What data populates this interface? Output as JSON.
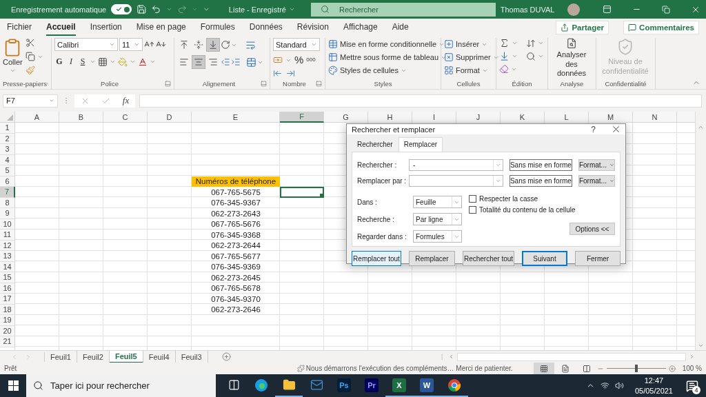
{
  "title_bar": {
    "autosave_label": "Enregistrement automatique",
    "autosave_on": true,
    "document_title": "Liste - Enregistré",
    "search_placeholder": "Rechercher",
    "user_name": "Thomas DUVAL"
  },
  "ribbon": {
    "tabs": [
      {
        "label": "Fichier",
        "selected": false
      },
      {
        "label": "Accueil",
        "selected": true
      },
      {
        "label": "Insertion",
        "selected": false
      },
      {
        "label": "Mise en page",
        "selected": false
      },
      {
        "label": "Formules",
        "selected": false
      },
      {
        "label": "Données",
        "selected": false
      },
      {
        "label": "Révision",
        "selected": false
      },
      {
        "label": "Affichage",
        "selected": false
      },
      {
        "label": "Aide",
        "selected": false
      }
    ],
    "share_label": "Partager",
    "comments_label": "Commentaires",
    "groups": [
      {
        "kind": "clipboard",
        "label": "Presse-papiers",
        "launcher": true,
        "paste_label": "Coller"
      },
      {
        "kind": "font",
        "label": "Police",
        "launcher": true,
        "font_name": "Calibri",
        "font_size": "11",
        "style_buttons": [
          "G",
          "I",
          "S"
        ]
      },
      {
        "kind": "alignment",
        "label": "Alignement",
        "launcher": true,
        "vertical": [
          {
            "selected": false
          },
          {
            "selected": false
          },
          {
            "selected": true
          }
        ],
        "horizontal": [
          {
            "selected": false
          },
          {
            "selected": true
          },
          {
            "selected": false
          }
        ]
      },
      {
        "kind": "number",
        "label": "Nombre",
        "launcher": true,
        "format": "Standard",
        "percent": "%",
        "thousands": "000"
      },
      {
        "kind": "styles",
        "label": "Styles",
        "launcher": false,
        "items": [
          "Mise en forme conditionnelle",
          "Mettre sous forme de tableau",
          "Styles de cellules"
        ]
      },
      {
        "kind": "cells",
        "label": "Cellules",
        "launcher": false,
        "items": [
          "Insérer",
          "Supprimer",
          "Format"
        ]
      },
      {
        "kind": "editing",
        "label": "Édition",
        "launcher": false
      },
      {
        "kind": "analysis",
        "label": "Analyse",
        "launcher": false,
        "button": "Analyser des données"
      },
      {
        "kind": "sensitivity",
        "label": "Confidentialité",
        "launcher": false,
        "button": "Niveau de confidentialité",
        "disabled": true
      }
    ]
  },
  "formula_bar": {
    "name_box": "F7",
    "function_label": "fx"
  },
  "sheet": {
    "columns": [
      {
        "label": "A",
        "selected": false
      },
      {
        "label": "B",
        "selected": false
      },
      {
        "label": "C",
        "selected": false
      },
      {
        "label": "D",
        "selected": false
      },
      {
        "label": "E",
        "selected": false
      },
      {
        "label": "F",
        "selected": true
      },
      {
        "label": "G",
        "selected": false
      },
      {
        "label": "H",
        "selected": false
      },
      {
        "label": "I",
        "selected": false
      },
      {
        "label": "J",
        "selected": false
      },
      {
        "label": "K",
        "selected": false
      },
      {
        "label": "L",
        "selected": false
      },
      {
        "label": "M",
        "selected": false
      },
      {
        "label": "N",
        "selected": false
      }
    ],
    "rows": [
      {
        "label": "1",
        "selected": false
      },
      {
        "label": "2",
        "selected": false
      },
      {
        "label": "3",
        "selected": false
      },
      {
        "label": "4",
        "selected": false
      },
      {
        "label": "5",
        "selected": false
      },
      {
        "label": "6",
        "selected": false,
        "cell_e": {
          "kind": "header",
          "text": "Numéros de téléphone"
        }
      },
      {
        "label": "7",
        "selected": true,
        "cell_e": {
          "kind": "value",
          "text": "067-765-5675"
        }
      },
      {
        "label": "8",
        "selected": false,
        "cell_e": {
          "kind": "value",
          "text": "076-345-9367"
        }
      },
      {
        "label": "9",
        "selected": false,
        "cell_e": {
          "kind": "value",
          "text": "062-273-2643"
        }
      },
      {
        "label": "10",
        "selected": false,
        "cell_e": {
          "kind": "value",
          "text": "067-765-5676"
        }
      },
      {
        "label": "11",
        "selected": false,
        "cell_e": {
          "kind": "value",
          "text": "076-345-9368"
        }
      },
      {
        "label": "12",
        "selected": false,
        "cell_e": {
          "kind": "value",
          "text": "062-273-2644"
        }
      },
      {
        "label": "13",
        "selected": false,
        "cell_e": {
          "kind": "value",
          "text": "067-765-5677"
        }
      },
      {
        "label": "14",
        "selected": false,
        "cell_e": {
          "kind": "value",
          "text": "076-345-9369"
        }
      },
      {
        "label": "15",
        "selected": false,
        "cell_e": {
          "kind": "value",
          "text": "062-273-2645"
        }
      },
      {
        "label": "16",
        "selected": false,
        "cell_e": {
          "kind": "value",
          "text": "067-765-5678"
        }
      },
      {
        "label": "17",
        "selected": false,
        "cell_e": {
          "kind": "value",
          "text": "076-345-9370"
        }
      },
      {
        "label": "18",
        "selected": false,
        "cell_e": {
          "kind": "value",
          "text": "062-273-2646"
        }
      },
      {
        "label": "19",
        "selected": false
      },
      {
        "label": "20",
        "selected": false
      },
      {
        "label": "21",
        "selected": false
      }
    ]
  },
  "sheet_tabs": [
    {
      "label": "Feuil1",
      "selected": false
    },
    {
      "label": "Feuil2",
      "selected": false
    },
    {
      "label": "Feuil5",
      "selected": true
    },
    {
      "label": "Feuil4",
      "selected": false
    },
    {
      "label": "Feuil3",
      "selected": false
    }
  ],
  "status_bar": {
    "ready": "Prêt",
    "message": "Nous démarrons l'exécution des compléments… Merci de patienter.",
    "views": [
      {
        "selected": true
      },
      {
        "selected": false
      },
      {
        "selected": false
      }
    ],
    "zoom": {
      "level": 0.5,
      "reading": "100 %"
    }
  },
  "dialog": {
    "title": "Rechercher et remplacer",
    "help": "?",
    "tabs": [
      {
        "label": "Rechercher",
        "selected": false
      },
      {
        "label": "Remplacer",
        "selected": true
      }
    ],
    "fields": [
      {
        "label": "Rechercher :",
        "value": "-",
        "format_preview": "Sans mise en forme",
        "format_button": "Format..."
      },
      {
        "label": "Remplacer par :",
        "format_preview": "Sans mise en forme",
        "format_button": "Format..."
      }
    ],
    "selects": [
      {
        "label": "Dans :",
        "value": "Feuille"
      },
      {
        "label": "Recherche :",
        "value": "Par ligne"
      },
      {
        "label": "Regarder dans :",
        "value": "Formules"
      }
    ],
    "checkboxes": [
      {
        "label": "Respecter la casse",
        "checked": false
      },
      {
        "label": "Totalité du contenu de la cellule",
        "checked": false
      }
    ],
    "options_button": "Options <<",
    "buttons": [
      {
        "label": "Remplacer tout",
        "kind": "hover"
      },
      {
        "label": "Remplacer",
        "kind": "normal"
      },
      {
        "label": "Rechercher tout",
        "kind": "normal"
      },
      {
        "label": "Suivant",
        "kind": "default"
      },
      {
        "label": "Fermer",
        "kind": "normal"
      }
    ]
  },
  "taskbar": {
    "search_placeholder": "Taper ici pour rechercher",
    "apps": [
      {
        "kind": "task_view",
        "running": false
      },
      {
        "kind": "edge",
        "running": false
      },
      {
        "kind": "explorer",
        "running": true
      },
      {
        "kind": "mail",
        "running": false
      },
      {
        "kind": "photoshop",
        "glyph": "Ps",
        "running": false
      },
      {
        "kind": "premiere",
        "glyph": "Pr",
        "running": false
      },
      {
        "kind": "excel",
        "glyph": "X",
        "running": true
      },
      {
        "kind": "word",
        "glyph": "W",
        "running": true
      },
      {
        "kind": "chrome",
        "running": true
      }
    ],
    "time": "12:47",
    "date": "05/05/2021",
    "notifications": "4"
  }
}
